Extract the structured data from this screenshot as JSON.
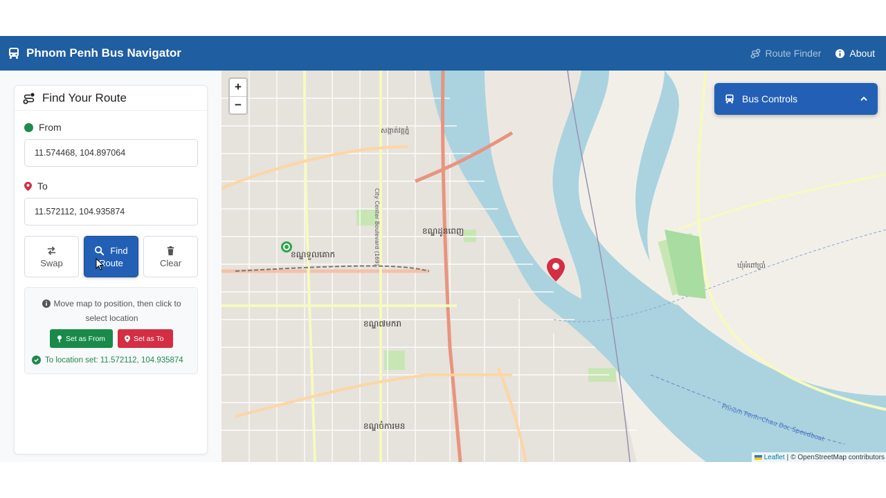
{
  "app": {
    "title": "Phnom Penh Bus Navigator"
  },
  "nav": {
    "route_finder": "Route Finder",
    "about": "About"
  },
  "panel": {
    "header": "Find Your Route",
    "from_label": "From",
    "from_value": "11.574468, 104.897064",
    "to_label": "To",
    "to_value": "11.572112, 104.935874",
    "buttons": {
      "swap": "Swap",
      "find_line1": "Find",
      "find_line2": "Route",
      "clear": "Clear"
    },
    "hint": "Move map to position, then click to select location",
    "set_from": "Set as From",
    "set_to": "Set as To",
    "status": "To location set: 11.572112, 104.935874"
  },
  "map": {
    "zoom_in": "+",
    "zoom_out": "−",
    "bus_controls": "Bus Controls",
    "attribution_leaflet": "Leaflet",
    "attribution_sep": "|",
    "attribution_osm": "© OpenStreetMap contributors",
    "labels": {
      "wat_phnom": "សង្កាត់វត្តភ្នំ",
      "tuol_kork": "ខណ្ឌទួលគោក",
      "daun_penh": "ខណ្ឌដូនពេញ",
      "prampir": "ខណ្ឌ៧មករា",
      "chamkar_mon": "ខណ្ឌចំការមន",
      "chbar_ampov": "ឃុំអំពៅប្រាំ",
      "ferry": "Phnom Penh–Chau Doc Speedboat",
      "city_center_blvd": "City Center Boulevard (169)"
    }
  },
  "colors": {
    "navbar": "#1f5ea0",
    "primary": "#2360b5",
    "green": "#198a4a",
    "red": "#d42e44",
    "water": "#aad3df",
    "land": "#f2efe9"
  }
}
